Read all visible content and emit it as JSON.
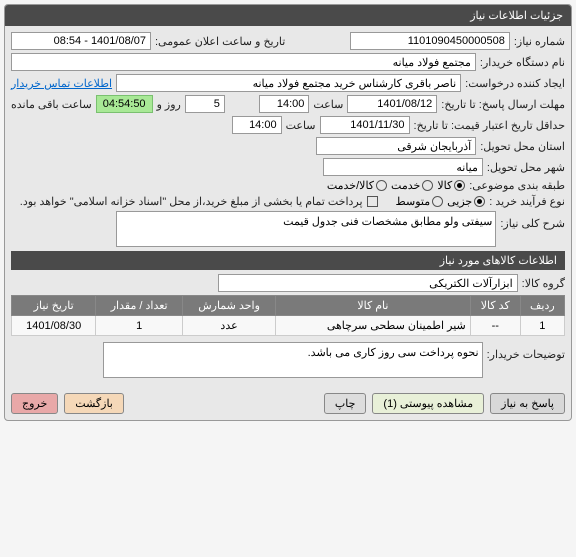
{
  "panel_title": "جزئیات اطلاعات نیاز",
  "need_number_label": "شماره نیاز:",
  "need_number": "1101090450000508",
  "announce_label": "تاریخ و ساعت اعلان عمومی:",
  "announce_value": "1401/08/07 - 08:54",
  "buyer_org_label": "نام دستگاه خریدار:",
  "buyer_org": "مجتمع فولاد میانه",
  "request_creator_label": "ایجاد کننده درخواست:",
  "request_creator": "ناصر باقری کارشناس خرید مجتمع فولاد میانه",
  "contact_link": "اطلاعات تماس خریدار",
  "deadline_label": "مهلت ارسال پاسخ: تا تاریخ:",
  "deadline_date": "1401/08/12",
  "time_label": "ساعت",
  "deadline_time": "14:00",
  "days_field": "5",
  "days_label": "روز و",
  "countdown": "04:54:50",
  "remaining_label": "ساعت باقی مانده",
  "validity_label": "حداقل تاریخ اعتبار قیمت: تا تاریخ:",
  "validity_date": "1401/11/30",
  "validity_time": "14:00",
  "province_label": "استان محل تحویل:",
  "province": "آذربایجان شرقی",
  "city_label": "شهر محل تحویل:",
  "city": "میانه",
  "category_label": "طبقه بندی موضوعی:",
  "cat_goods": "کالا",
  "cat_service": "خدمت",
  "cat_goods_service": "کالا/خدمت",
  "process_label": "نوع فرآیند خرید :",
  "proc_partial": "جزیی",
  "proc_medium": "متوسط",
  "payment_note": "پرداخت تمام یا بخشی از مبلغ خرید،از محل \"اسناد خزانه اسلامی\" خواهد بود.",
  "need_desc_label": "شرح کلی نیاز:",
  "need_desc": "سیفتی ولو مطابق مشخصات فنی جدول قیمت",
  "goods_section": "اطلاعات کالاهای مورد نیاز",
  "goods_group_label": "گروه کالا:",
  "goods_group": "ابزارآلات الکتریکی",
  "table": {
    "headers": [
      "ردیف",
      "کد کالا",
      "نام کالا",
      "واحد شمارش",
      "تعداد / مقدار",
      "تاریخ نیاز"
    ],
    "row": {
      "idx": "1",
      "code": "--",
      "name": "شیر اطمینان سطحی سرچاهی",
      "unit": "عدد",
      "qty": "1",
      "date": "1401/08/30"
    }
  },
  "buyer_notes_label": "توضیحات خریدار:",
  "buyer_notes": "نحوه پرداخت سی روز کاری می باشد.",
  "btn_reply": "پاسخ به نیاز",
  "btn_attach": "مشاهده پیوستی (1)",
  "btn_print": "چاپ",
  "btn_back": "بازگشت",
  "btn_exit": "خروج"
}
